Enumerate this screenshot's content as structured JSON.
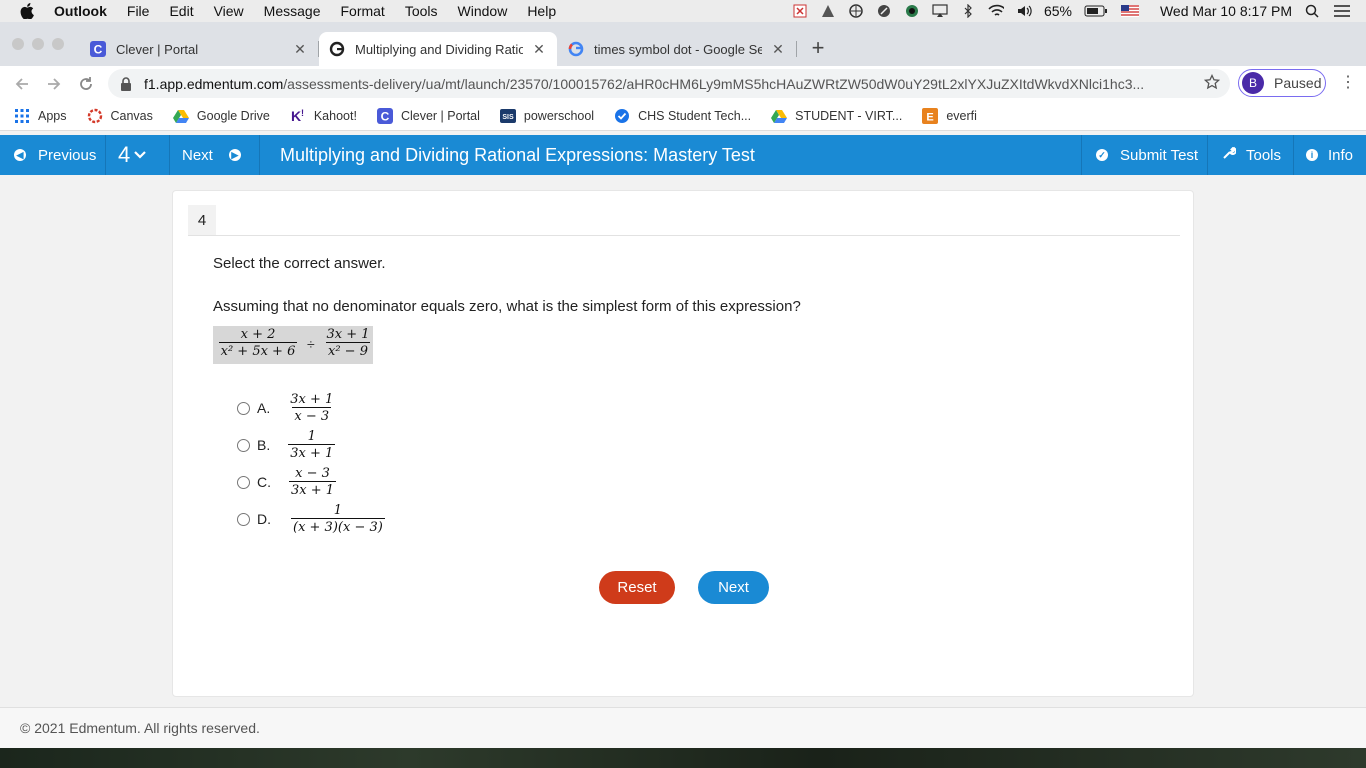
{
  "menubar": {
    "app": "Outlook",
    "items": [
      "File",
      "Edit",
      "View",
      "Message",
      "Format",
      "Tools",
      "Window",
      "Help"
    ],
    "battery": "65%",
    "datetime": "Wed Mar 10  8:17 PM"
  },
  "tabs": [
    {
      "title": "Clever | Portal",
      "close": "✕"
    },
    {
      "title": "Multiplying and Dividing Rational",
      "close": "✕"
    },
    {
      "title": "times symbol dot - Google Sea",
      "close": "✕"
    }
  ],
  "newtab": "+",
  "address": {
    "host": "f1.app.edmentum.com",
    "path": "/assessments-delivery/ua/mt/launch/23570/100015762/aHR0cHM6Ly9mMS5hcHAuZWRtZW50dW0uY29tL2xlYXJuZXItdWkvdXNlci1hc3..."
  },
  "profile": {
    "initial": "B",
    "label": "Paused"
  },
  "bookmarks": [
    "Apps",
    "Canvas",
    "Google Drive",
    "Kahoot!",
    "Clever | Portal",
    "powerschool",
    "CHS Student Tech...",
    "STUDENT - VIRT...",
    "everfi"
  ],
  "header": {
    "previous": "Previous",
    "question_number": "4",
    "next": "Next",
    "title": "Multiplying and Dividing Rational Expressions: Mastery Test",
    "submit": "Submit Test",
    "tools": "Tools",
    "info": "Info"
  },
  "question": {
    "number": "4",
    "instruction": "Select the correct answer.",
    "prompt": "Assuming that no denominator equals zero, what is the simplest form of this expression?",
    "expression": {
      "left_num": "x + 2",
      "left_den": "x² + 5x + 6",
      "operator": "÷",
      "right_num": "3x + 1",
      "right_den": "x² − 9"
    },
    "options": [
      {
        "letter": "A.",
        "num": "3x + 1",
        "den": "x − 3"
      },
      {
        "letter": "B.",
        "num": "1",
        "den": "3x + 1"
      },
      {
        "letter": "C.",
        "num": "x − 3",
        "den": "3x + 1"
      },
      {
        "letter": "D.",
        "num": "1",
        "den": "(x + 3)(x − 3)"
      }
    ]
  },
  "buttons": {
    "reset": "Reset",
    "next": "Next"
  },
  "footer": "© 2021 Edmentum. All rights reserved."
}
